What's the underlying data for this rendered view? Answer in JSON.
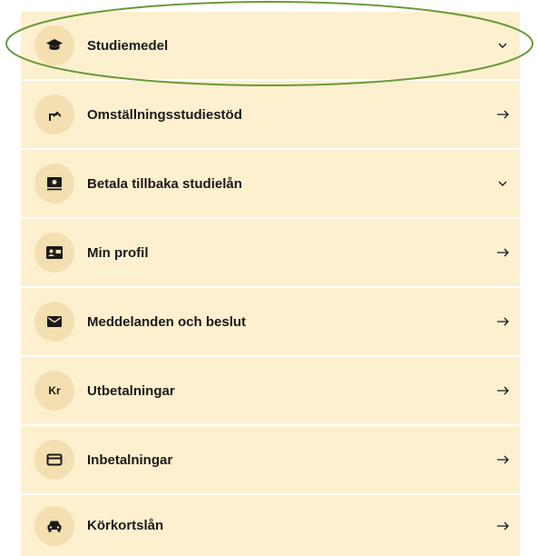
{
  "menu": {
    "items": [
      {
        "label": "Studiemedel",
        "icon": "graduation-cap-icon",
        "trailing": "chevron-down-icon"
      },
      {
        "label": "Omställningsstudiestöd",
        "icon": "turn-up-arrow-icon",
        "trailing": "arrow-right-icon"
      },
      {
        "label": "Betala tillbaka studielån",
        "icon": "money-icon",
        "trailing": "chevron-down-icon"
      },
      {
        "label": "Min profil",
        "icon": "id-card-icon",
        "trailing": "arrow-right-icon"
      },
      {
        "label": "Meddelanden och beslut",
        "icon": "envelope-icon",
        "trailing": "arrow-right-icon"
      },
      {
        "label": "Utbetalningar",
        "icon": "kronor-icon",
        "icon_text": "Kr",
        "trailing": "arrow-right-icon"
      },
      {
        "label": "Inbetalningar",
        "icon": "credit-card-icon",
        "trailing": "arrow-right-icon"
      },
      {
        "label": "Körkortslån",
        "icon": "car-icon",
        "trailing": "arrow-right-icon"
      }
    ]
  },
  "colors": {
    "item_bg": "#fdf0cf",
    "icon_bg": "#f4dfb0",
    "highlight": "#6a9a3a",
    "text": "#1a1a1a"
  }
}
